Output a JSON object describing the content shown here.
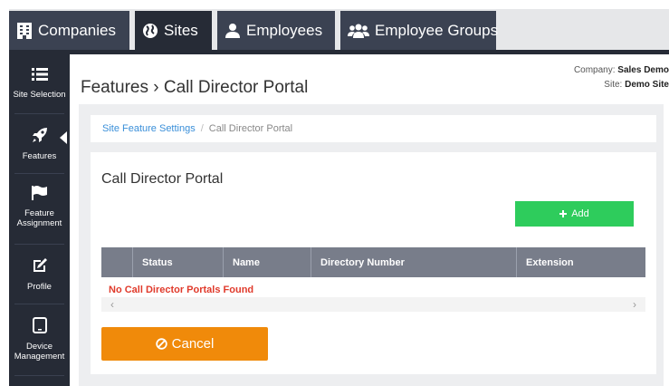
{
  "top_tabs": [
    {
      "label": "Companies",
      "icon": "building-icon"
    },
    {
      "label": "Sites",
      "icon": "globe-icon"
    },
    {
      "label": "Employees",
      "icon": "user-icon"
    },
    {
      "label": "Employee Groups",
      "icon": "users-icon"
    }
  ],
  "sidebar": {
    "items": [
      {
        "label": "Site Selection",
        "icon": "list-icon"
      },
      {
        "label": "Features",
        "icon": "rocket-icon"
      },
      {
        "label": "Feature Assignment",
        "icon": "flag-icon"
      },
      {
        "label": "Profile",
        "icon": "edit-icon"
      },
      {
        "label": "Device Management",
        "icon": "tablet-icon"
      }
    ],
    "active": "Features"
  },
  "header": {
    "title": "Features › Call Director Portal",
    "company_label": "Company:",
    "company_value": "Sales Demo",
    "site_label": "Site:",
    "site_value": "Demo Site"
  },
  "breadcrumb": {
    "link": "Site Feature Settings",
    "separator": "/",
    "current": "Call Director Portal"
  },
  "panel": {
    "title": "Call Director Portal",
    "add_label": "Add",
    "table": {
      "columns": [
        "",
        "Status",
        "Name",
        "Directory Number",
        "Extension"
      ],
      "empty_message": "No Call Director Portals Found"
    },
    "cancel_label": "Cancel"
  },
  "colors": {
    "dark_nav": "#262b36",
    "tab": "#3b4252",
    "add_green": "#2ecc5c",
    "cancel_orange": "#f08a0a",
    "link_blue": "#3a8fd9",
    "error_red": "#e03a2b",
    "table_header": "#787d8a"
  }
}
